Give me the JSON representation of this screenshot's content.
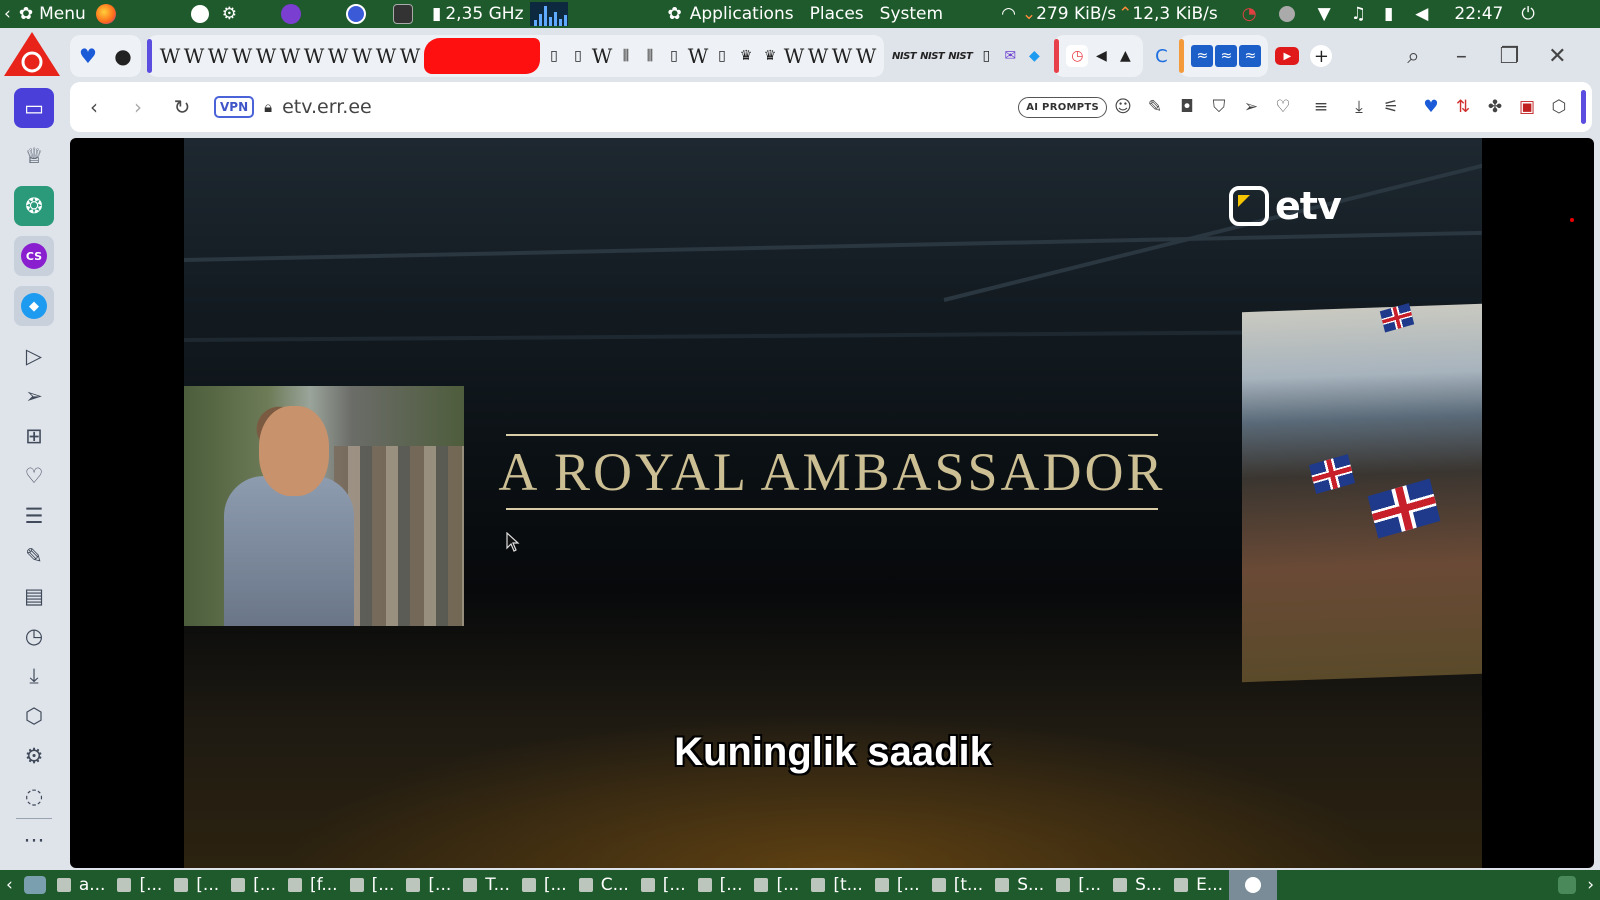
{
  "system_panel": {
    "menu_label": "Menu",
    "cpu_freq": "2,35 GHz",
    "applications_label": "Applications",
    "places_label": "Places",
    "system_label": "System",
    "net_down": "279 KiB/s",
    "net_up": "12,3 KiB/s",
    "clock": "22:47"
  },
  "tab_strip": {
    "wiki_glyph": "W",
    "nist_label": "NIST"
  },
  "address_bar": {
    "vpn_label": "VPN",
    "url_host": "etv.err.ee",
    "ai_prompts_label": "AI PROMPTS"
  },
  "video": {
    "title": "A ROYAL AMBASSADOR",
    "subtitle": "Kuninglik saadik",
    "channel_logo_text": "etv"
  },
  "taskbar": {
    "tasks": [
      "a...",
      "[...",
      "[...",
      "[...",
      "[f...",
      "[...",
      "[...",
      "T...",
      "[...",
      "C...",
      "[...",
      "[...",
      "[...",
      "[t...",
      "[...",
      "[t...",
      "S...",
      "[...",
      "S...",
      "E..."
    ]
  },
  "colors": {
    "panel_green": "#1f5a2c",
    "title_gold": "#cdbf94",
    "opera_red": "#e8231a",
    "sidebar_bg": "#dfe3ea"
  }
}
